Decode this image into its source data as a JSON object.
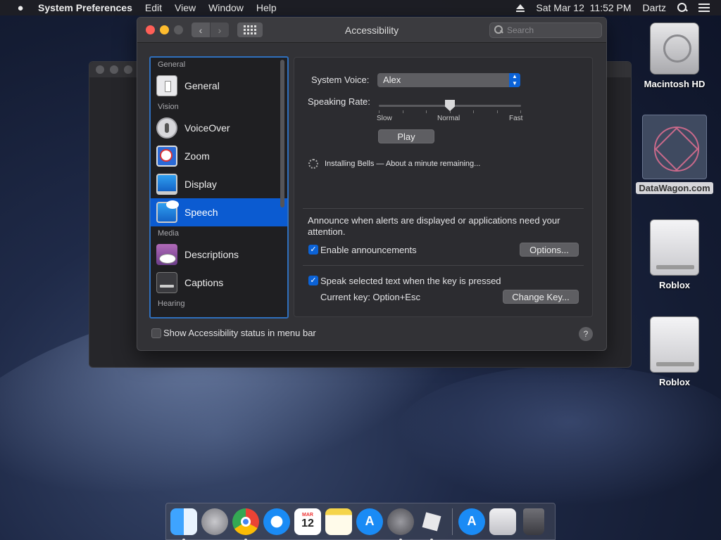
{
  "menubar": {
    "app_name": "System Preferences",
    "menus": [
      "Edit",
      "View",
      "Window",
      "Help"
    ],
    "datetime": "Sat Mar 12  11:52 PM",
    "user": "Dartz"
  },
  "window": {
    "title": "Accessibility",
    "search_placeholder": "Search"
  },
  "sidebar": {
    "headers": {
      "general": "General",
      "vision": "Vision",
      "media": "Media",
      "hearing": "Hearing"
    },
    "items": [
      {
        "label": "General",
        "icon": "general-icon"
      },
      {
        "label": "VoiceOver",
        "icon": "voiceover-icon"
      },
      {
        "label": "Zoom",
        "icon": "zoom-icon"
      },
      {
        "label": "Display",
        "icon": "display-icon"
      },
      {
        "label": "Speech",
        "icon": "speech-icon",
        "selected": true
      },
      {
        "label": "Descriptions",
        "icon": "descriptions-icon"
      },
      {
        "label": "Captions",
        "icon": "captions-icon"
      }
    ]
  },
  "speech": {
    "system_voice_label": "System Voice:",
    "system_voice_value": "Alex",
    "speaking_rate_label": "Speaking Rate:",
    "rate_labels": {
      "slow": "Slow",
      "normal": "Normal",
      "fast": "Fast"
    },
    "rate_fraction": 0.5,
    "play_label": "Play",
    "install_status": "Installing Bells — About a minute remaining...",
    "announce_text": "Announce when alerts are displayed or applications need your attention.",
    "enable_announcements_label": "Enable announcements",
    "enable_announcements_checked": true,
    "options_label": "Options...",
    "speak_selected_label": "Speak selected text when the key is pressed",
    "speak_selected_checked": true,
    "current_key_text": "Current key: Option+Esc",
    "change_key_label": "Change Key..."
  },
  "footer": {
    "show_status_label": "Show Accessibility status in menu bar",
    "show_status_checked": false,
    "help_label": "?"
  },
  "desktop": {
    "icons": [
      {
        "label": "Macintosh HD",
        "icon": "hard-drive-icon"
      },
      {
        "label": "DataWagon.com",
        "icon": "datawagon-icon"
      },
      {
        "label": "Roblox",
        "icon": "external-drive-icon"
      },
      {
        "label": "Roblox",
        "icon": "external-drive-icon"
      }
    ]
  },
  "dock": {
    "apps": [
      {
        "name": "finder-icon"
      },
      {
        "name": "launchpad-icon"
      },
      {
        "name": "chrome-icon"
      },
      {
        "name": "safari-icon"
      },
      {
        "name": "calendar-icon",
        "month": "MAR",
        "day": "12"
      },
      {
        "name": "notes-icon"
      },
      {
        "name": "app-store-icon"
      },
      {
        "name": "system-preferences-icon"
      },
      {
        "name": "roblox-icon"
      },
      {
        "name": "installer-icon"
      },
      {
        "name": "preview-icon"
      },
      {
        "name": "trash-icon"
      }
    ]
  },
  "colors": {
    "accent": "#0b5bd1",
    "close": "#ff5f57",
    "minimize": "#febc2e"
  }
}
